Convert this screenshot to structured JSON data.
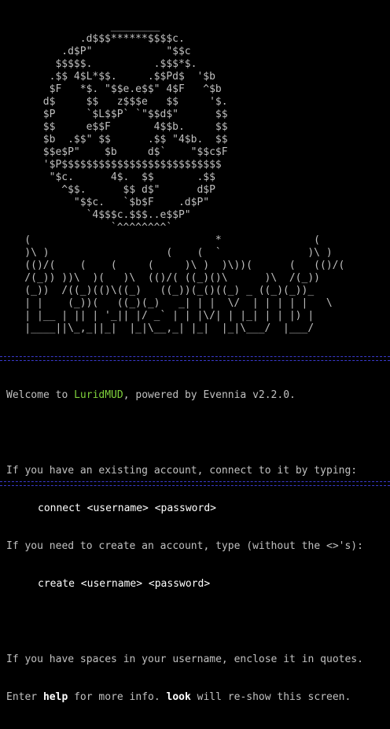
{
  "colors": {
    "background": "#000000",
    "text": "#c0c0c0",
    "accent_game_name": "#7fd13b",
    "command": "#ffffff",
    "separator": "#3a3acc"
  },
  "banner": {
    "skull_art": [
      "                  ________",
      "             .d$$$******$$$$c.",
      "          .d$P\"            \"$$c",
      "         $$$$$.          .$$$*$.",
      "        .$$ 4$L*$$.     .$$Pd$  '$b",
      "        $F   *$. \"$$e.e$$\" 4$F   ^$b",
      "       d$     $$   z$$$e   $$     '$.",
      "       $P     `$L$$P` `\"$$d$\"      $$",
      "       $$     e$$F       4$$b.     $$",
      "       $b  .$$\" $$      .$$ \"4$b.  $$",
      "       $$e$P\"    $b     d$`    \"$$c$F",
      "       '$P$$$$$$$$$$$$$$$$$$$$$$$$$$",
      "        \"$c.      4$.  $$       .$$",
      "          ^$$.      $$ d$\"      d$P",
      "            \"$$c.   `$b$F    .d$P\"",
      "              `4$$$c.$$$..e$$P\"",
      "                  `^^^^^^^^`"
    ],
    "title_art": [
      "    (                              *               (",
      "    )\\ )                   (    (  `              )\\ )",
      "    (()/(    (    (     (     )\\ )  )\\))(      (   (()/(",
      "    /(_)) ))\\  )(   )\\  (()/( ((_)()\\      )\\  /(_))",
      "    (_))  /((_)(()\\((_)   ((_))(_()((_) _ ((_)(_))_",
      "    | |    (_))(   ((_)(_)   _| | |  \\/  | | | | |   \\",
      "    | |__ | || | '_|| |/ _` | | |\\/| | |_| | | |) |",
      "    |____||\\_,_||_|  |_|\\__,_| |_|  |_|\\___/  |___/"
    ]
  },
  "message": {
    "welcome_prefix": "Welcome to ",
    "game_name": "LuridMUD",
    "welcome_suffix": ", powered by Evennia v2.2.0.",
    "existing_account_text": "If you have an existing account, connect to it by typing:",
    "connect_command": "connect <username> <password>",
    "create_account_text": "If you need to create an account, type (without the <>'s):",
    "create_command": "create <username> <password>",
    "spaces_text": "If you have spaces in your username, enclose it in quotes.",
    "help_prefix": "Enter ",
    "help_keyword": "help",
    "help_middle": " for more info. ",
    "look_keyword": "look",
    "help_suffix": " will re-show this screen."
  }
}
